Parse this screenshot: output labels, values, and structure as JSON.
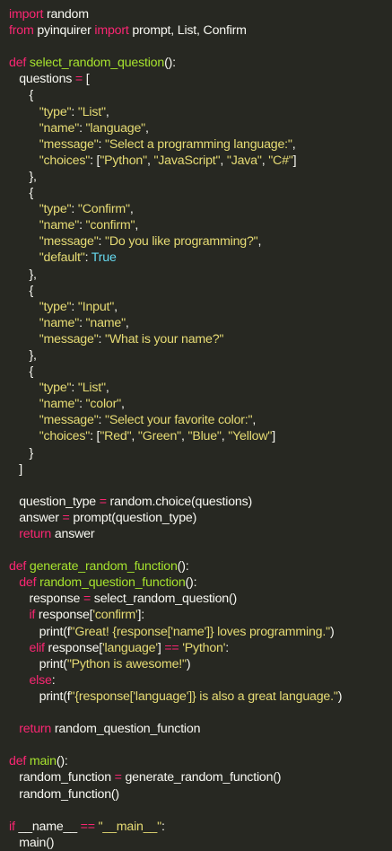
{
  "editor": {
    "theme": {
      "background": "#272822",
      "plain": "#f8f8f2",
      "keyword": "#f92672",
      "function": "#a6e22e",
      "string": "#e6db74",
      "constant": "#66d9ef"
    },
    "lines": [
      [
        {
          "t": "kw",
          "v": "import"
        },
        {
          "t": "plain",
          "v": " random"
        }
      ],
      [
        {
          "t": "kw",
          "v": "from"
        },
        {
          "t": "plain",
          "v": " pyinquirer "
        },
        {
          "t": "kw",
          "v": "import"
        },
        {
          "t": "plain",
          "v": " prompt, List, Confirm"
        }
      ],
      [],
      [
        {
          "t": "kw",
          "v": "def"
        },
        {
          "t": "plain",
          "v": " "
        },
        {
          "t": "fn",
          "v": "select_random_question"
        },
        {
          "t": "plain",
          "v": "():"
        }
      ],
      [
        {
          "t": "plain",
          "v": "   questions "
        },
        {
          "t": "op",
          "v": "="
        },
        {
          "t": "plain",
          "v": " ["
        }
      ],
      [
        {
          "t": "plain",
          "v": "      {"
        }
      ],
      [
        {
          "t": "plain",
          "v": "         "
        },
        {
          "t": "str",
          "v": "\"type\""
        },
        {
          "t": "plain",
          "v": ": "
        },
        {
          "t": "str",
          "v": "\"List\""
        },
        {
          "t": "plain",
          "v": ","
        }
      ],
      [
        {
          "t": "plain",
          "v": "         "
        },
        {
          "t": "str",
          "v": "\"name\""
        },
        {
          "t": "plain",
          "v": ": "
        },
        {
          "t": "str",
          "v": "\"language\""
        },
        {
          "t": "plain",
          "v": ","
        }
      ],
      [
        {
          "t": "plain",
          "v": "         "
        },
        {
          "t": "str",
          "v": "\"message\""
        },
        {
          "t": "plain",
          "v": ": "
        },
        {
          "t": "str",
          "v": "\"Select a programming language:\""
        },
        {
          "t": "plain",
          "v": ","
        }
      ],
      [
        {
          "t": "plain",
          "v": "         "
        },
        {
          "t": "str",
          "v": "\"choices\""
        },
        {
          "t": "plain",
          "v": ": ["
        },
        {
          "t": "str",
          "v": "\"Python\""
        },
        {
          "t": "plain",
          "v": ", "
        },
        {
          "t": "str",
          "v": "\"JavaScript\""
        },
        {
          "t": "plain",
          "v": ", "
        },
        {
          "t": "str",
          "v": "\"Java\""
        },
        {
          "t": "plain",
          "v": ", "
        },
        {
          "t": "str",
          "v": "\"C#\""
        },
        {
          "t": "plain",
          "v": "]"
        }
      ],
      [
        {
          "t": "plain",
          "v": "      },"
        }
      ],
      [
        {
          "t": "plain",
          "v": "      {"
        }
      ],
      [
        {
          "t": "plain",
          "v": "         "
        },
        {
          "t": "str",
          "v": "\"type\""
        },
        {
          "t": "plain",
          "v": ": "
        },
        {
          "t": "str",
          "v": "\"Confirm\""
        },
        {
          "t": "plain",
          "v": ","
        }
      ],
      [
        {
          "t": "plain",
          "v": "         "
        },
        {
          "t": "str",
          "v": "\"name\""
        },
        {
          "t": "plain",
          "v": ": "
        },
        {
          "t": "str",
          "v": "\"confirm\""
        },
        {
          "t": "plain",
          "v": ","
        }
      ],
      [
        {
          "t": "plain",
          "v": "         "
        },
        {
          "t": "str",
          "v": "\"message\""
        },
        {
          "t": "plain",
          "v": ": "
        },
        {
          "t": "str",
          "v": "\"Do you like programming?\""
        },
        {
          "t": "plain",
          "v": ","
        }
      ],
      [
        {
          "t": "plain",
          "v": "         "
        },
        {
          "t": "str",
          "v": "\"default\""
        },
        {
          "t": "plain",
          "v": ": "
        },
        {
          "t": "const",
          "v": "True"
        }
      ],
      [
        {
          "t": "plain",
          "v": "      },"
        }
      ],
      [
        {
          "t": "plain",
          "v": "      {"
        }
      ],
      [
        {
          "t": "plain",
          "v": "         "
        },
        {
          "t": "str",
          "v": "\"type\""
        },
        {
          "t": "plain",
          "v": ": "
        },
        {
          "t": "str",
          "v": "\"Input\""
        },
        {
          "t": "plain",
          "v": ","
        }
      ],
      [
        {
          "t": "plain",
          "v": "         "
        },
        {
          "t": "str",
          "v": "\"name\""
        },
        {
          "t": "plain",
          "v": ": "
        },
        {
          "t": "str",
          "v": "\"name\""
        },
        {
          "t": "plain",
          "v": ","
        }
      ],
      [
        {
          "t": "plain",
          "v": "         "
        },
        {
          "t": "str",
          "v": "\"message\""
        },
        {
          "t": "plain",
          "v": ": "
        },
        {
          "t": "str",
          "v": "\"What is your name?\""
        }
      ],
      [
        {
          "t": "plain",
          "v": "      },"
        }
      ],
      [
        {
          "t": "plain",
          "v": "      {"
        }
      ],
      [
        {
          "t": "plain",
          "v": "         "
        },
        {
          "t": "str",
          "v": "\"type\""
        },
        {
          "t": "plain",
          "v": ": "
        },
        {
          "t": "str",
          "v": "\"List\""
        },
        {
          "t": "plain",
          "v": ","
        }
      ],
      [
        {
          "t": "plain",
          "v": "         "
        },
        {
          "t": "str",
          "v": "\"name\""
        },
        {
          "t": "plain",
          "v": ": "
        },
        {
          "t": "str",
          "v": "\"color\""
        },
        {
          "t": "plain",
          "v": ","
        }
      ],
      [
        {
          "t": "plain",
          "v": "         "
        },
        {
          "t": "str",
          "v": "\"message\""
        },
        {
          "t": "plain",
          "v": ": "
        },
        {
          "t": "str",
          "v": "\"Select your favorite color:\""
        },
        {
          "t": "plain",
          "v": ","
        }
      ],
      [
        {
          "t": "plain",
          "v": "         "
        },
        {
          "t": "str",
          "v": "\"choices\""
        },
        {
          "t": "plain",
          "v": ": ["
        },
        {
          "t": "str",
          "v": "\"Red\""
        },
        {
          "t": "plain",
          "v": ", "
        },
        {
          "t": "str",
          "v": "\"Green\""
        },
        {
          "t": "plain",
          "v": ", "
        },
        {
          "t": "str",
          "v": "\"Blue\""
        },
        {
          "t": "plain",
          "v": ", "
        },
        {
          "t": "str",
          "v": "\"Yellow\""
        },
        {
          "t": "plain",
          "v": "]"
        }
      ],
      [
        {
          "t": "plain",
          "v": "      }"
        }
      ],
      [
        {
          "t": "plain",
          "v": "   ]"
        }
      ],
      [],
      [
        {
          "t": "plain",
          "v": "   question_type "
        },
        {
          "t": "op",
          "v": "="
        },
        {
          "t": "plain",
          "v": " random.choice(questions)"
        }
      ],
      [
        {
          "t": "plain",
          "v": "   answer "
        },
        {
          "t": "op",
          "v": "="
        },
        {
          "t": "plain",
          "v": " prompt(question_type)"
        }
      ],
      [
        {
          "t": "plain",
          "v": "   "
        },
        {
          "t": "kw",
          "v": "return"
        },
        {
          "t": "plain",
          "v": " answer"
        }
      ],
      [],
      [
        {
          "t": "kw",
          "v": "def"
        },
        {
          "t": "plain",
          "v": " "
        },
        {
          "t": "fn",
          "v": "generate_random_function"
        },
        {
          "t": "plain",
          "v": "():"
        }
      ],
      [
        {
          "t": "plain",
          "v": "   "
        },
        {
          "t": "kw",
          "v": "def"
        },
        {
          "t": "plain",
          "v": " "
        },
        {
          "t": "fn",
          "v": "random_question_function"
        },
        {
          "t": "plain",
          "v": "():"
        }
      ],
      [
        {
          "t": "plain",
          "v": "      response "
        },
        {
          "t": "op",
          "v": "="
        },
        {
          "t": "plain",
          "v": " select_random_question()"
        }
      ],
      [
        {
          "t": "plain",
          "v": "      "
        },
        {
          "t": "kw",
          "v": "if"
        },
        {
          "t": "plain",
          "v": " response["
        },
        {
          "t": "str",
          "v": "'confirm'"
        },
        {
          "t": "plain",
          "v": "]:"
        }
      ],
      [
        {
          "t": "plain",
          "v": "         print(f"
        },
        {
          "t": "str",
          "v": "\"Great! {response['name']} loves programming.\""
        },
        {
          "t": "plain",
          "v": ")"
        }
      ],
      [
        {
          "t": "plain",
          "v": "      "
        },
        {
          "t": "kw",
          "v": "elif"
        },
        {
          "t": "plain",
          "v": " response["
        },
        {
          "t": "str",
          "v": "'language'"
        },
        {
          "t": "plain",
          "v": "] "
        },
        {
          "t": "op",
          "v": "=="
        },
        {
          "t": "plain",
          "v": " "
        },
        {
          "t": "str",
          "v": "'Python'"
        },
        {
          "t": "plain",
          "v": ":"
        }
      ],
      [
        {
          "t": "plain",
          "v": "         print("
        },
        {
          "t": "str",
          "v": "\"Python is awesome!\""
        },
        {
          "t": "plain",
          "v": ")"
        }
      ],
      [
        {
          "t": "plain",
          "v": "      "
        },
        {
          "t": "kw",
          "v": "else"
        },
        {
          "t": "plain",
          "v": ":"
        }
      ],
      [
        {
          "t": "plain",
          "v": "         print(f"
        },
        {
          "t": "str",
          "v": "\"{response['language']} is also a great language.\""
        },
        {
          "t": "plain",
          "v": ")"
        }
      ],
      [],
      [
        {
          "t": "plain",
          "v": "   "
        },
        {
          "t": "kw",
          "v": "return"
        },
        {
          "t": "plain",
          "v": " random_question_function"
        }
      ],
      [],
      [
        {
          "t": "kw",
          "v": "def"
        },
        {
          "t": "plain",
          "v": " "
        },
        {
          "t": "fn",
          "v": "main"
        },
        {
          "t": "plain",
          "v": "():"
        }
      ],
      [
        {
          "t": "plain",
          "v": "   random_function "
        },
        {
          "t": "op",
          "v": "="
        },
        {
          "t": "plain",
          "v": " generate_random_function()"
        }
      ],
      [
        {
          "t": "plain",
          "v": "   random_function()"
        }
      ],
      [],
      [
        {
          "t": "kw",
          "v": "if"
        },
        {
          "t": "plain",
          "v": " __name__ "
        },
        {
          "t": "op",
          "v": "=="
        },
        {
          "t": "plain",
          "v": " "
        },
        {
          "t": "str",
          "v": "\"__main__\""
        },
        {
          "t": "plain",
          "v": ":"
        }
      ],
      [
        {
          "t": "plain",
          "v": "   main()"
        }
      ]
    ]
  }
}
